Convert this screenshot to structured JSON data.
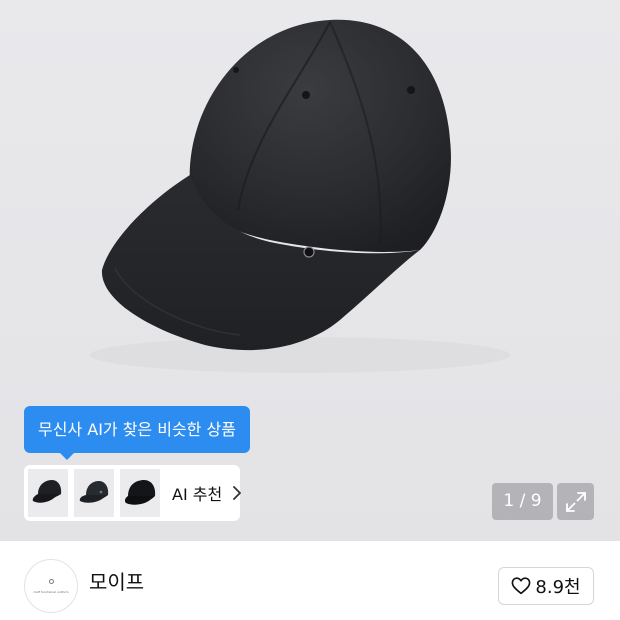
{
  "product_image": {
    "icon": "black-cap-image",
    "background_color": "#e7e7ea"
  },
  "ai_tooltip": {
    "text": "무신사 AI가 찾은 비슷한 상품",
    "color": "#2d8cf0"
  },
  "ai_recommendation": {
    "thumbnails": [
      "cap-thumbnail-1",
      "cap-thumbnail-2",
      "cap-thumbnail-3"
    ],
    "label": "AI 추천",
    "chevron_icon": "chevron-right-icon"
  },
  "image_counter": {
    "text": "1 / 9"
  },
  "fullscreen": {
    "icon": "expand-icon"
  },
  "brand": {
    "logo_text": "mofl functional uniform",
    "name": "모이프"
  },
  "like": {
    "icon": "heart-icon",
    "count": "8.9천"
  }
}
